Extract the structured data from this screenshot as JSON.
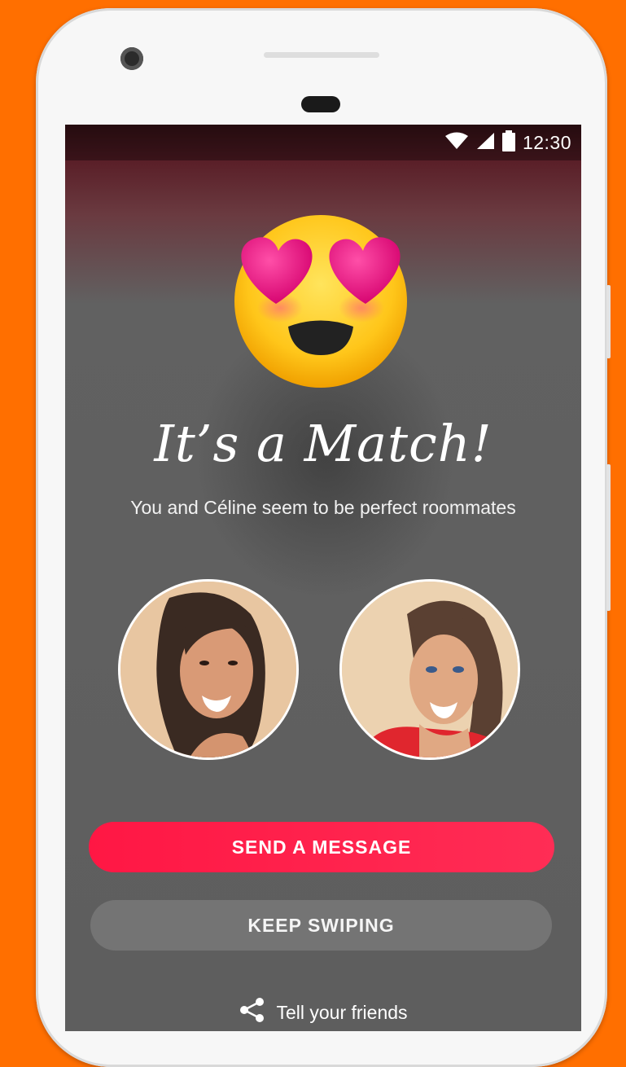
{
  "status_bar": {
    "time": "12:30",
    "icons": [
      "wifi-icon",
      "cell-signal-icon",
      "battery-icon"
    ]
  },
  "match": {
    "emoji": "heart-eyes-emoji",
    "title": "It’s a Match!",
    "subtitle": "You and Céline seem to be perfect roommates"
  },
  "profiles": [
    {
      "role": "you",
      "image": "woman-with-dark-hair-photo"
    },
    {
      "role": "match",
      "image": "woman-in-red-top-photo"
    }
  ],
  "actions": {
    "send_message": "SEND A MESSAGE",
    "keep_swiping": "KEEP SWIPING",
    "share": "Tell your friends"
  },
  "colors": {
    "background": "#ff6f00",
    "primary_button": "#ff1744",
    "secondary_button": "#787878"
  }
}
